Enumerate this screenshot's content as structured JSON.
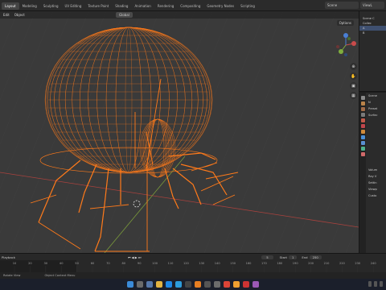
{
  "workspace_tabs": [
    "Layout",
    "Modeling",
    "Sculpting",
    "UV Editing",
    "Texture Paint",
    "Shading",
    "Animation",
    "Rendering",
    "Compositing",
    "Geometry Nodes",
    "Scripting"
  ],
  "active_tab_index": 0,
  "scene_name": "Scene",
  "view_layer": "ViewL",
  "viewport": {
    "menus": [
      "Edit",
      "Object"
    ],
    "transform_orientation": "Global",
    "options_label": "Options"
  },
  "outliner": {
    "rows": [
      "Scene C",
      "Collec",
      "A",
      "B"
    ]
  },
  "properties": {
    "rows": [
      "Scene",
      "N",
      "Preset",
      "Surfac",
      "Volum",
      "Ray V",
      "Settin",
      "Viewp",
      "Custo"
    ]
  },
  "timeline": {
    "playback_label": "Playback",
    "current_frame": "5",
    "start_label": "Start",
    "start_value": "1",
    "end_label": "End",
    "end_value": "250",
    "ticks": [
      "10",
      "20",
      "30",
      "40",
      "50",
      "60",
      "70",
      "80",
      "90",
      "100",
      "110",
      "120",
      "130",
      "140",
      "150",
      "160",
      "170",
      "180",
      "190",
      "200",
      "210",
      "220",
      "230",
      "240",
      "250"
    ]
  },
  "statusbar": {
    "left": "Rotate View",
    "middle": "Object Context Menu"
  },
  "colors": {
    "wireframe": "#ff7a1a",
    "viewport_bg": "#3a3a3a",
    "axis_x": "#a8423e",
    "axis_y": "#7a9a3a",
    "timeline_playhead": "#4a6fb5"
  }
}
